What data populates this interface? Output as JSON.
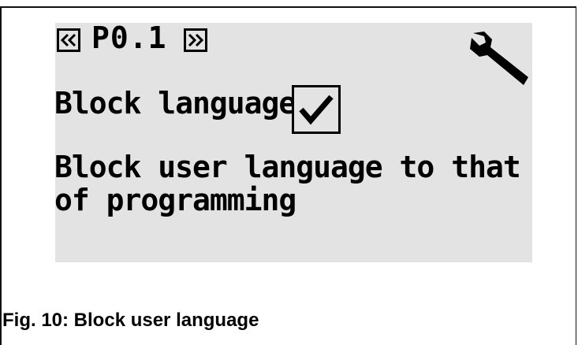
{
  "device_screen": {
    "nav_prev_icon": "double-chevron-left-icon",
    "nav_next_icon": "double-chevron-right-icon",
    "parameter_code": "P0.1",
    "settings_icon": "wrench-icon",
    "parameter_name": "Block language",
    "checkbox_checked": true,
    "checkbox_icon": "checkmark-icon",
    "description": "Block user language to that of programming",
    "background_color": "#e3e3e3"
  },
  "caption": "Fig. 10: Block user language"
}
